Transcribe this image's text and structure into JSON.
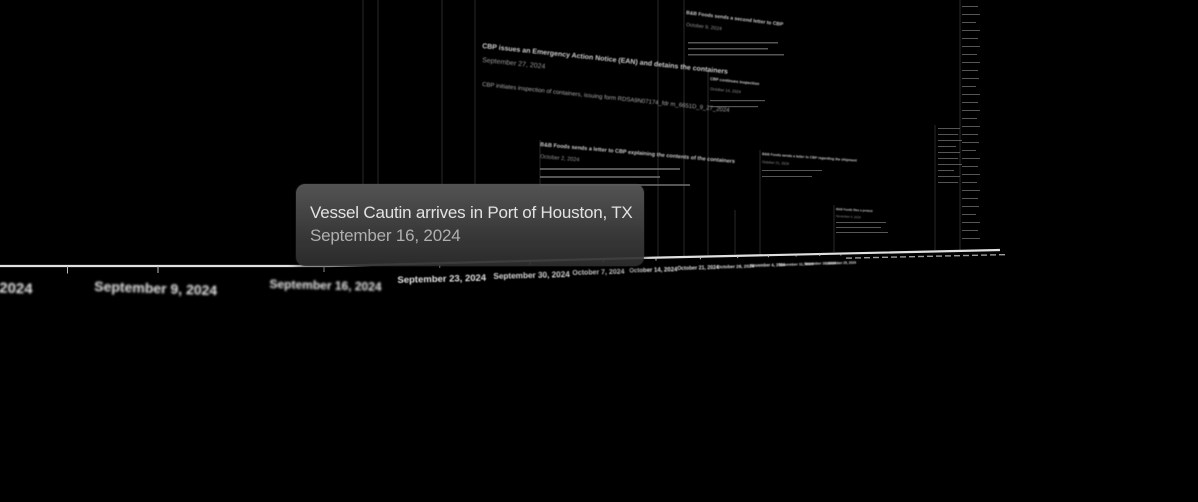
{
  "tooltip": {
    "title": "Vessel Cautin arrives in Port of Houston, TX",
    "date": "September 16, 2024"
  },
  "axis": {
    "tick_labels": [
      "2024",
      "September 9, 2024",
      "September 16, 2024",
      "September 23, 2024",
      "September 30, 2024",
      "October 7, 2024",
      "October 14, 2024",
      "October 21, 2024",
      "October 28, 2024",
      "November 4, 2024",
      "November 11, 2024",
      "November 18, 2024",
      "November 25, 2024"
    ]
  },
  "events": [
    {
      "title": "CBP issues an Emergency Action Notice (EAN) and detains the containers",
      "date": "September 27, 2024",
      "body": "CBP initiates inspection of containers, issuing form RDSA9N07174_fdr m_6651D_9_27_2024"
    },
    {
      "title": "B&B Foods sends a letter to CBP explaining the contents of the containers",
      "date": "October 2, 2024"
    },
    {
      "title": "B&B Foods sends a second letter to CBP",
      "date": "October 9, 2024"
    },
    {
      "title": "CBP continues inspection",
      "date": "October 14, 2024"
    },
    {
      "title": "B&B Foods sends a letter to CBP regarding the shipment",
      "date": "October 21, 2024"
    },
    {
      "title": "B&B Foods files a protest",
      "date": "November 4, 2024"
    }
  ],
  "colors": {
    "background": "#000000",
    "axis_line": "#e0e0e0",
    "tooltip_bg": "#4a4a4a",
    "tooltip_title": "#f4f4f4",
    "tooltip_date": "#bdbdbd"
  }
}
